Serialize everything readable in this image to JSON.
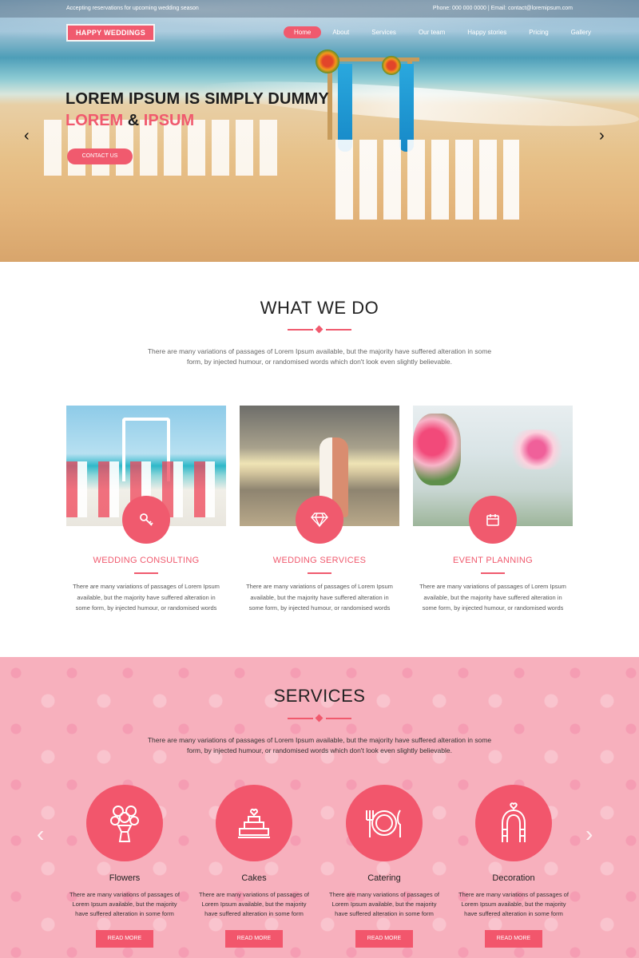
{
  "topbar": {
    "left": "Accepting reservations for upcoming wedding season",
    "right": "Phone: 000 000 0000 | Email: contact@loremipsum.com"
  },
  "logo": "HAPPY WEDDINGS",
  "nav": [
    "Home",
    "About",
    "Services",
    "Our team",
    "Happy stories",
    "Pricing",
    "Gallery"
  ],
  "hero": {
    "line1": "LOREM IPSUM IS SIMPLY DUMMY",
    "line2a": "LOREM",
    "amp": "&",
    "line2b": "IPSUM",
    "button": "CONTACT US",
    "prev": "‹",
    "next": "›"
  },
  "whatwedo": {
    "title": "WHAT WE DO",
    "intro": "There are many variations of passages of Lorem Ipsum available, but the majority have suffered alteration in some form, by injected humour, or randomised words which don't look even slightly believable.",
    "cards": [
      {
        "title": "WEDDING CONSULTING",
        "icon": "key-icon",
        "text": "There are many variations of passages of Lorem Ipsum available, but the majority have suffered alteration in some form, by injected humour, or randomised words"
      },
      {
        "title": "WEDDING SERVICES",
        "icon": "diamond-icon",
        "text": "There are many variations of passages of Lorem Ipsum available, but the majority have suffered alteration in some form, by injected humour, or randomised words"
      },
      {
        "title": "EVENT PLANNING",
        "icon": "calendar-icon",
        "text": "There are many variations of passages of Lorem Ipsum available, but the majority have suffered alteration in some form, by injected humour, or randomised words"
      }
    ]
  },
  "services": {
    "title": "SERVICES",
    "intro": "There are many variations of passages of Lorem Ipsum available, but the majority have suffered alteration in some form, by injected humour, or randomised words which don't look even slightly believable.",
    "items": [
      {
        "name": "Flowers",
        "icon": "bouquet-icon",
        "text": "There are many variations of passages of Lorem Ipsum available, but the majority have suffered alteration in some form",
        "button": "READ MORE"
      },
      {
        "name": "Cakes",
        "icon": "cake-icon",
        "text": "There are many variations of passages of Lorem Ipsum available, but the majority have suffered alteration in some form",
        "button": "READ MORE"
      },
      {
        "name": "Catering",
        "icon": "plate-cutlery-icon",
        "text": "There are many variations of passages of Lorem Ipsum available, but the majority have suffered alteration in some form",
        "button": "READ MORE"
      },
      {
        "name": "Decoration",
        "icon": "arch-icon",
        "text": "There are many variations of passages of Lorem Ipsum available, but the majority have suffered alteration in some form",
        "button": "READ MORE"
      }
    ]
  },
  "colors": {
    "accent": "#f05a6e",
    "pink_bg": "#f7b0bd"
  }
}
